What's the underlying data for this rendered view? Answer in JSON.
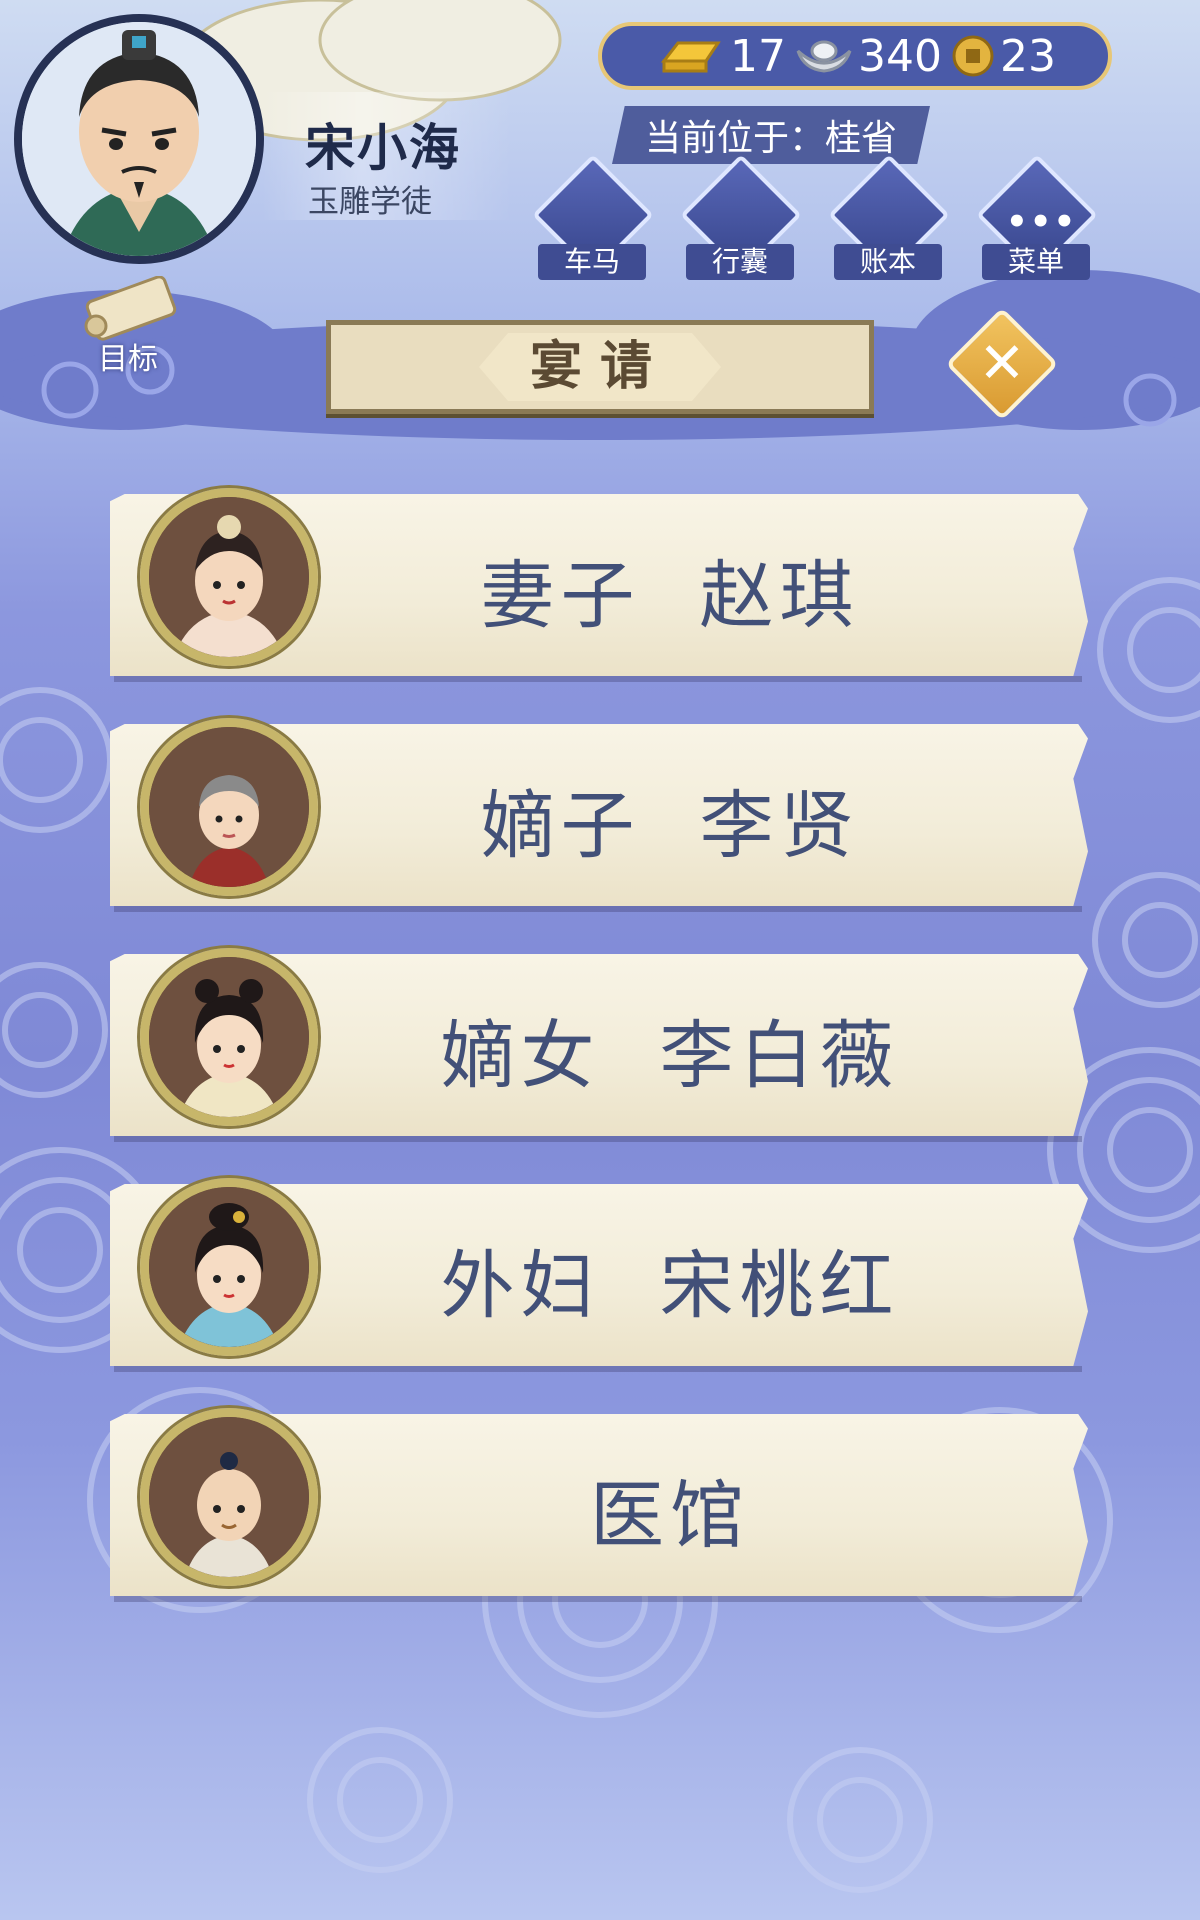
{
  "player": {
    "name": "宋小海",
    "title": "玉雕学徒"
  },
  "currency": {
    "gold": "17",
    "silver": "340",
    "coins": "23"
  },
  "location": {
    "text": "当前位于：桂省"
  },
  "top_menu": [
    {
      "label": "车马",
      "icon": "carriage-icon"
    },
    {
      "label": "行囊",
      "icon": "bag-icon"
    },
    {
      "label": "账本",
      "icon": "ledger-icon"
    },
    {
      "label": "菜单",
      "icon": "more-icon"
    }
  ],
  "goal": {
    "label": "目标",
    "icon": "scroll-icon"
  },
  "panel": {
    "title": "宴请",
    "close_icon": "close-icon"
  },
  "invite_list": [
    {
      "label": "妻子  赵琪"
    },
    {
      "label": "嫡子  李贤"
    },
    {
      "label": "嫡女  李白薇"
    },
    {
      "label": "外妇  宋桃红"
    },
    {
      "label": "医馆"
    }
  ],
  "colors": {
    "accent_blue": "#4a5aa8",
    "gold": "#e7c777",
    "scroll": "#f4efde",
    "label": "#425078"
  }
}
